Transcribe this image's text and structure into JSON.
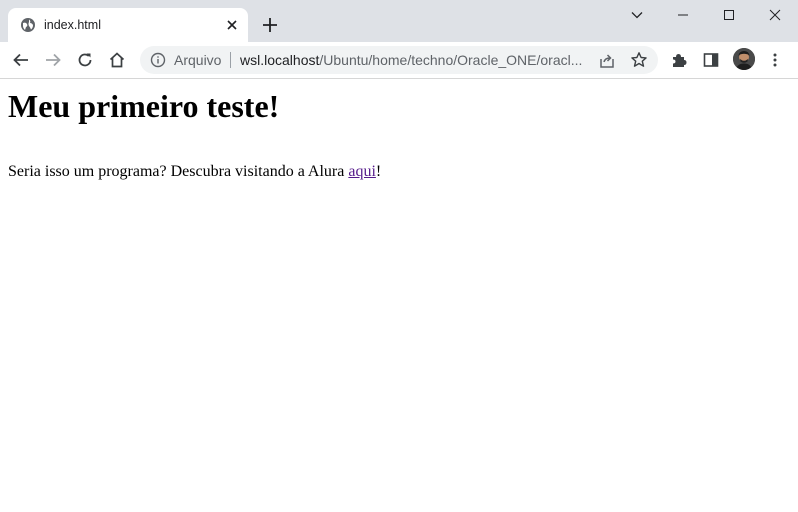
{
  "browser": {
    "tab": {
      "title": "index.html",
      "favicon": "globe-icon"
    },
    "omnibox": {
      "security_label": "Arquivo",
      "url_host": "wsl.localhost",
      "url_path": "/Ubuntu/home/techno/Oracle_ONE/oracl..."
    },
    "colors": {
      "tabstrip": "#dee1e6",
      "omnibox": "#f1f3f4",
      "visited_link": "#551a8b"
    }
  },
  "page": {
    "heading": "Meu primeiro teste!",
    "paragraph_text": "Seria isso um programa? Descubra visitando a Alura ",
    "link_text": "aqui",
    "paragraph_end": "!"
  }
}
